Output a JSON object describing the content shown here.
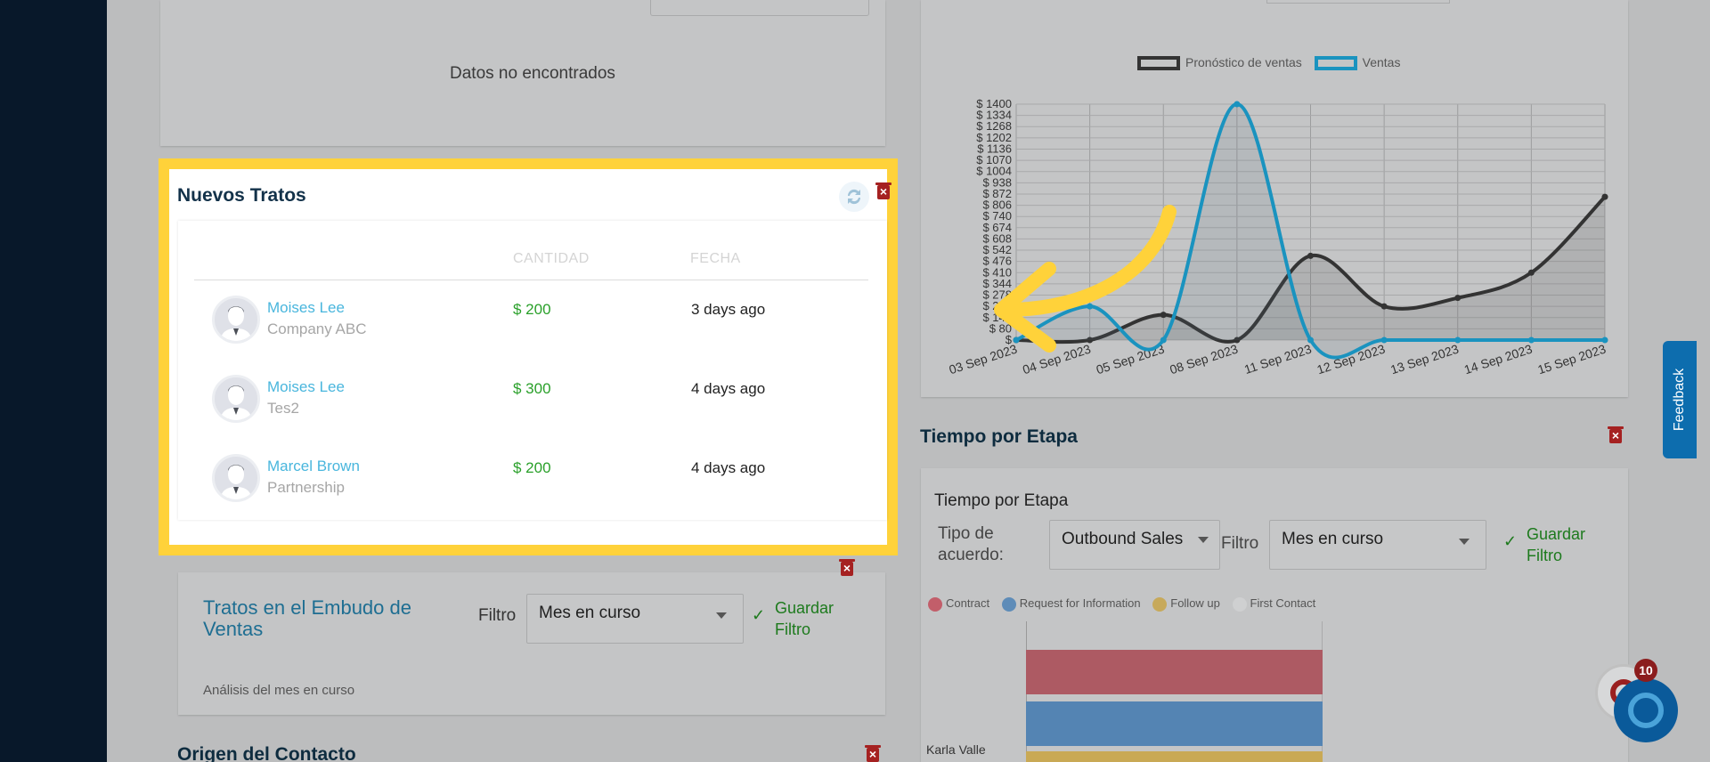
{
  "left_top": {
    "empty_text": "Datos no encontrados"
  },
  "nuevos_tratos": {
    "title": "Nuevos Tratos",
    "columns": [
      "",
      "CANTIDAD",
      "FECHA"
    ],
    "rows": [
      {
        "name": "Moises Lee",
        "company": "Company ABC",
        "amount": "$ 200",
        "date": "3 days ago"
      },
      {
        "name": "Moises Lee",
        "company": "Tes2",
        "amount": "$ 300",
        "date": "4 days ago"
      },
      {
        "name": "Marcel Brown",
        "company": "Partnership",
        "amount": "$ 200",
        "date": "4 days ago"
      }
    ]
  },
  "embudo": {
    "title": "Tratos en el Embudo de Ventas",
    "filter_label": "Filtro",
    "filter_value": "Mes en curso",
    "save_label": "Guardar Filtro",
    "analysis_text": "Análisis del mes en curso"
  },
  "origen": {
    "title": "Origen del Contacto"
  },
  "sales_chart": {
    "legend": [
      "Pronóstico de ventas",
      "Ventas"
    ]
  },
  "tiempo": {
    "section_title": "Tiempo por Etapa",
    "card_title": "Tiempo por Etapa",
    "deal_type_label": "Tipo de acuerdo:",
    "deal_type_value": "Outbound Sales",
    "filter_label": "Filtro",
    "filter_value": "Mes en curso",
    "save_label": "Guardar Filtro",
    "legend": [
      "Contract",
      "Request for Information",
      "Follow up",
      "First Contact"
    ],
    "legend_colors": [
      "#c25e6a",
      "#5e8cb8",
      "#c7a95a",
      "#cfd0d1"
    ],
    "row_label": "Karla Valle",
    "bars": [
      {
        "stage": "Contract",
        "color": "#ad5a63"
      },
      {
        "stage": "Request for Information",
        "color": "#5484b3"
      },
      {
        "stage": "Follow up",
        "color": "#c9a955"
      }
    ]
  },
  "feedback": {
    "label": "Feedback"
  },
  "notifications": {
    "count": "10"
  },
  "colors": {
    "accent": "#ffd23a",
    "link": "#49b6dd",
    "amount": "#2aa02a",
    "sidebar": "#08182a"
  },
  "chart_data": {
    "type": "line",
    "x": [
      "03 Sep 2023",
      "04 Sep 2023",
      "05 Sep 2023",
      "08 Sep 2023",
      "11 Sep 2023",
      "12 Sep 2023",
      "13 Sep 2023",
      "14 Sep 2023",
      "15 Sep 2023"
    ],
    "series": [
      {
        "name": "Pronóstico de ventas",
        "values": [
          0,
          0,
          150,
          0,
          500,
          200,
          250,
          400,
          850
        ]
      },
      {
        "name": "Ventas",
        "values": [
          0,
          200,
          0,
          1400,
          0,
          0,
          0,
          0,
          0
        ]
      }
    ],
    "y_ticks": [
      "$ 1400",
      "$ 1334",
      "$ 1268",
      "$ 1202",
      "$ 1136",
      "$ 1070",
      "$ 1004",
      "$ 938",
      "$ 872",
      "$ 806",
      "$ 740",
      "$ 674",
      "$ 608",
      "$ 542",
      "$ 476",
      "$ 410",
      "$ 344",
      "$ 278",
      "$ 212",
      "$ 146",
      "$ 80",
      "$"
    ],
    "ylim": [
      0,
      1400
    ],
    "grid": true,
    "legend_position": "top"
  }
}
